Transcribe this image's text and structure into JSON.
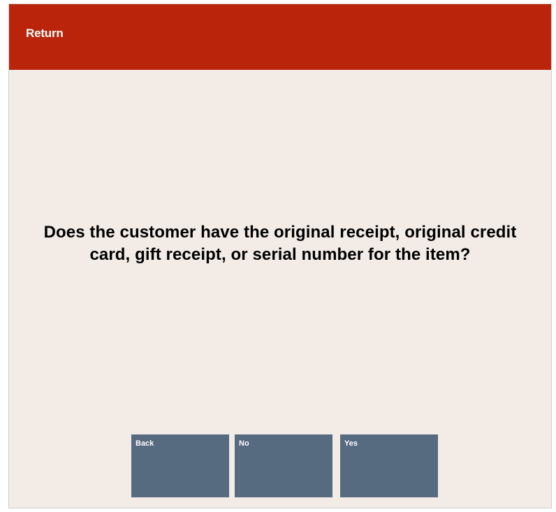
{
  "header": {
    "title": "Return"
  },
  "prompt": {
    "text": "Does the customer have the original receipt, original credit card, gift receipt, or serial number for the item?"
  },
  "buttons": [
    {
      "label": "Back"
    },
    {
      "label": "No"
    },
    {
      "label": "Yes"
    }
  ],
  "colors": {
    "header_bg": "#b9240a",
    "body_bg": "#f2ebe6",
    "button_bg": "#566a80"
  }
}
